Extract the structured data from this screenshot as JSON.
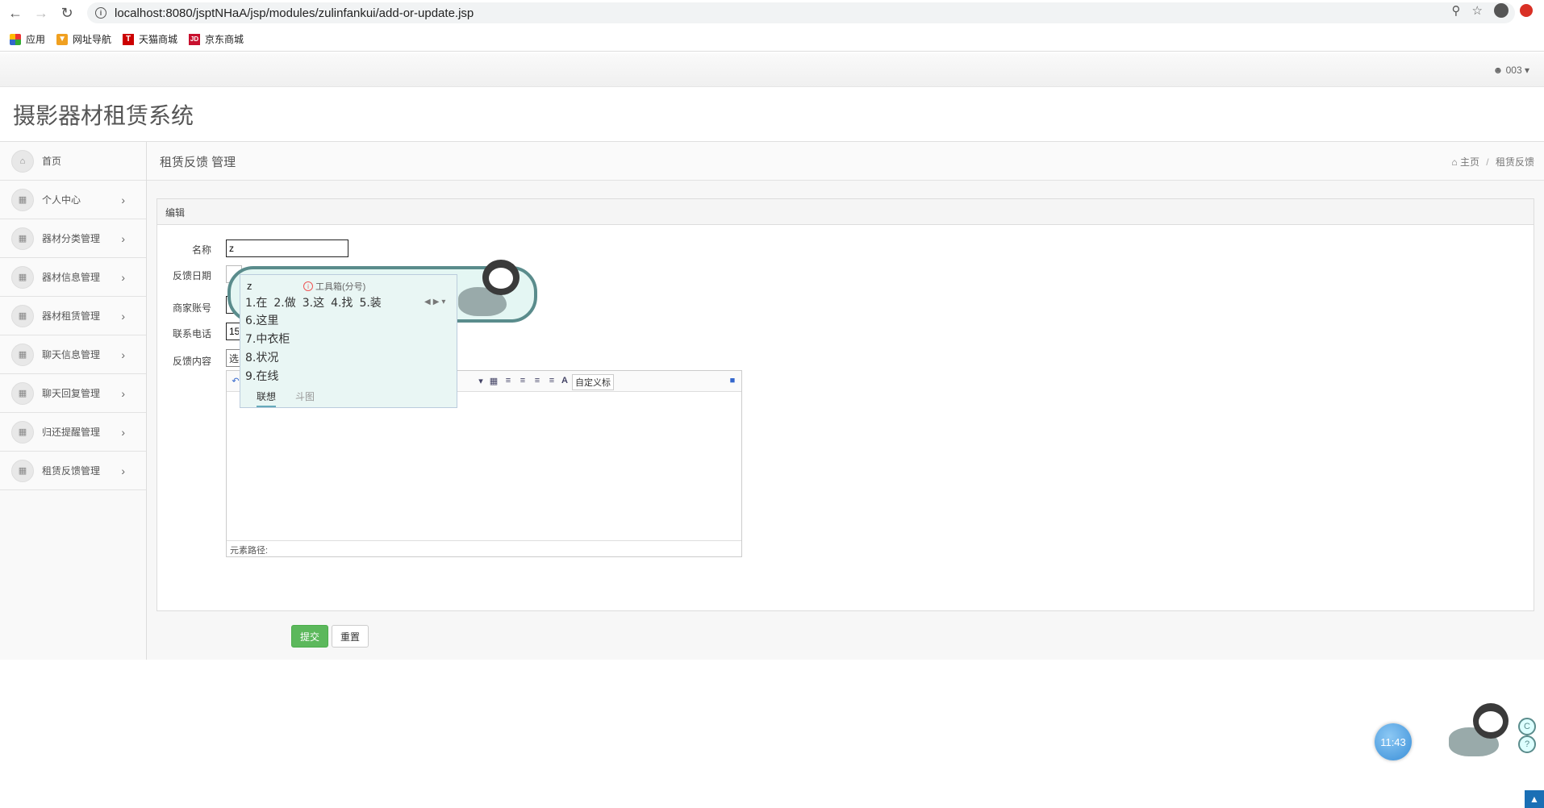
{
  "browser": {
    "url": "localhost:8080/jsptNHaA/jsp/modules/zulinfankui/add-or-update.jsp",
    "bookmarks": [
      {
        "label": "应用",
        "icon": "apps-grid-icon"
      },
      {
        "label": "网址导航",
        "icon": "nav-icon"
      },
      {
        "label": "天猫商城",
        "icon": "tmall-icon"
      },
      {
        "label": "京东商城",
        "icon": "jd-icon"
      }
    ],
    "tmall_glyph": "T",
    "jd_glyph": "JD"
  },
  "header": {
    "user_label": "003",
    "app_title": "摄影器材租赁系统"
  },
  "sidebar": {
    "items": [
      {
        "label": "首页",
        "icon": "home-icon",
        "has_chevron": false
      },
      {
        "label": "个人中心",
        "icon": "table-icon",
        "has_chevron": true
      },
      {
        "label": "器材分类管理",
        "icon": "table-icon",
        "has_chevron": true
      },
      {
        "label": "器材信息管理",
        "icon": "table-icon",
        "has_chevron": true
      },
      {
        "label": "器材租赁管理",
        "icon": "table-icon",
        "has_chevron": true
      },
      {
        "label": "聊天信息管理",
        "icon": "table-icon",
        "has_chevron": true
      },
      {
        "label": "聊天回复管理",
        "icon": "table-icon",
        "has_chevron": true
      },
      {
        "label": "归还提醒管理",
        "icon": "table-icon",
        "has_chevron": true
      },
      {
        "label": "租赁反馈管理",
        "icon": "table-icon",
        "has_chevron": true
      }
    ]
  },
  "page": {
    "title": "租赁反馈 管理",
    "breadcrumb_home": "主页",
    "breadcrumb_current": "租赁反馈"
  },
  "form": {
    "panel_title": "编辑",
    "fields": {
      "name_label": "名称",
      "name_value": "z",
      "date_label": "反馈日期",
      "account_label": "商家账号",
      "account_value": "0",
      "phone_label": "联系电话",
      "phone_value": "15",
      "content_label": "反馈内容",
      "content_select_value": "选"
    },
    "editor": {
      "custom_title_select": "自定义标",
      "status_path": "元素路径:"
    },
    "submit_label": "提交",
    "reset_label": "重置"
  },
  "ime": {
    "composition": "z",
    "toolbox_label": "工具箱(分号)",
    "candidates_row1": [
      "1.在",
      "2.做",
      "3.这",
      "4.找",
      "5.装"
    ],
    "candidates_more": [
      "6.这里",
      "7.中衣柜",
      "8.状况",
      "9.在线"
    ],
    "tab_active": "联想",
    "tab_other": "斗图"
  },
  "widgets": {
    "clock": "11:43"
  }
}
